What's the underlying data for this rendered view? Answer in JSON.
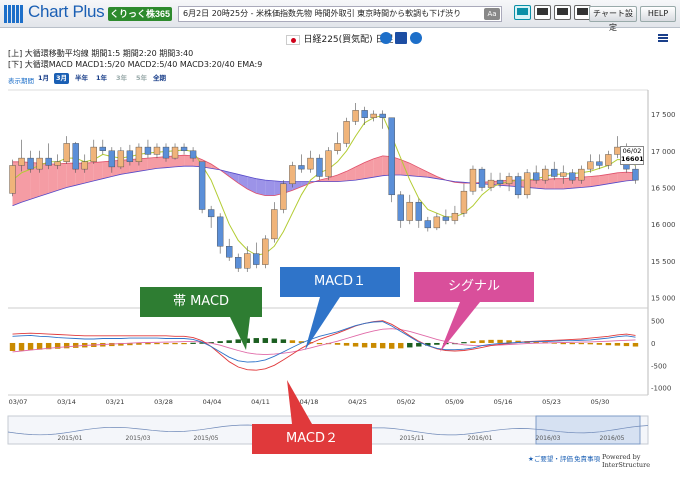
{
  "app": {
    "logo_text": "Chart Plus",
    "brand_badge": "くりっく株365"
  },
  "ticker": {
    "text": "6月2日 20時25分 - 米株価指数先物 時間外取引 東京時間から軟調も下げ渋り",
    "button": "Aa"
  },
  "toolbar": {
    "settings_label": "チャート設定",
    "help_label": "HELP"
  },
  "chart_header": {
    "title": "日経225(買気配) 日足"
  },
  "legend": {
    "line1": "[上] 大循環移動平均線  期間1:5  期間2:20  期間3:40",
    "line2": "[下] 大循環MACD  MACD1:5/20  MACD2:5/40  MACD3:20/40  EMA:9"
  },
  "periods": {
    "label": "表示期間",
    "items": [
      {
        "label": "1月",
        "active": false
      },
      {
        "label": "3月",
        "active": true
      },
      {
        "label": "半年",
        "active": false
      },
      {
        "label": "1年",
        "active": false
      },
      {
        "label": "3年",
        "active": false
      },
      {
        "label": "5年",
        "active": false
      },
      {
        "label": "全期",
        "active": false
      }
    ]
  },
  "price_axis": [
    "17 500",
    "17 000",
    "16 500",
    "16 000",
    "15 500",
    "15 000"
  ],
  "macd_axis": [
    "500",
    "0",
    "-500",
    "-1000"
  ],
  "date_axis": [
    "03/07",
    "03/14",
    "03/21",
    "03/28",
    "04/04",
    "04/11",
    "04/18",
    "04/25",
    "05/02",
    "05/09",
    "05/16",
    "05/23",
    "05/30"
  ],
  "nav_axis": [
    "2015/01",
    "2015/03",
    "2015/05",
    "2015/11",
    "2016/01",
    "2016/03",
    "2016/05"
  ],
  "price_tag": {
    "date": "06/02",
    "value": "16601"
  },
  "callouts": {
    "obi_macd": "帯 MACD",
    "macd1": "MACD１",
    "signal": "シグナル",
    "macd2": "MACD２"
  },
  "footer": {
    "link1": "★ご要望・評価",
    "link2": "免責事項",
    "powered": "Powered by InterStructure"
  },
  "colors": {
    "candle_up": "#f0b47a",
    "candle_down": "#5b8fd8",
    "ma_short": "#b3cc33",
    "cloud_red": "#f27b86",
    "cloud_blue": "#7b6fe0",
    "callout_green": "#2e7d32",
    "callout_blue": "#2f74c9",
    "callout_pink": "#d94f9b",
    "callout_red": "#e0393b"
  },
  "chart_data": {
    "type": "candlestick",
    "price_ylim": [
      14900,
      17800
    ],
    "candles": [
      {
        "o": 16420,
        "c": 16800,
        "h": 16880,
        "l": 16380
      },
      {
        "o": 16800,
        "c": 16900,
        "h": 17150,
        "l": 16720
      },
      {
        "o": 16900,
        "c": 16750,
        "h": 17000,
        "l": 16700
      },
      {
        "o": 16750,
        "c": 16900,
        "h": 17000,
        "l": 16700
      },
      {
        "o": 16900,
        "c": 16800,
        "h": 17100,
        "l": 16750
      },
      {
        "o": 16800,
        "c": 16850,
        "h": 16950,
        "l": 16750
      },
      {
        "o": 16850,
        "c": 17100,
        "h": 17200,
        "l": 16820
      },
      {
        "o": 17100,
        "c": 16750,
        "h": 17120,
        "l": 16700
      },
      {
        "o": 16750,
        "c": 16850,
        "h": 16950,
        "l": 16700
      },
      {
        "o": 16850,
        "c": 17050,
        "h": 17150,
        "l": 16820
      },
      {
        "o": 17050,
        "c": 17000,
        "h": 17150,
        "l": 16950
      },
      {
        "o": 17000,
        "c": 16780,
        "h": 17050,
        "l": 16700
      },
      {
        "o": 16780,
        "c": 17000,
        "h": 17050,
        "l": 16750
      },
      {
        "o": 17000,
        "c": 16850,
        "h": 17080,
        "l": 16800
      },
      {
        "o": 16850,
        "c": 17050,
        "h": 17100,
        "l": 16800
      },
      {
        "o": 17050,
        "c": 16950,
        "h": 17150,
        "l": 16900
      },
      {
        "o": 16950,
        "c": 17050,
        "h": 17100,
        "l": 16900
      },
      {
        "o": 17050,
        "c": 16900,
        "h": 17100,
        "l": 16850
      },
      {
        "o": 16900,
        "c": 17050,
        "h": 17100,
        "l": 16880
      },
      {
        "o": 17050,
        "c": 17000,
        "h": 17100,
        "l": 16950
      },
      {
        "o": 17000,
        "c": 16900,
        "h": 17050,
        "l": 16850
      },
      {
        "o": 16850,
        "c": 16200,
        "h": 16850,
        "l": 16150
      },
      {
        "o": 16200,
        "c": 16100,
        "h": 16250,
        "l": 15950
      },
      {
        "o": 16100,
        "c": 15700,
        "h": 16150,
        "l": 15600
      },
      {
        "o": 15700,
        "c": 15550,
        "h": 15800,
        "l": 15500
      },
      {
        "o": 15550,
        "c": 15400,
        "h": 15600,
        "l": 15350
      },
      {
        "o": 15400,
        "c": 15600,
        "h": 15700,
        "l": 15350
      },
      {
        "o": 15600,
        "c": 15450,
        "h": 15750,
        "l": 15400
      },
      {
        "o": 15450,
        "c": 15800,
        "h": 15850,
        "l": 15400
      },
      {
        "o": 15800,
        "c": 16200,
        "h": 16300,
        "l": 15750
      },
      {
        "o": 16200,
        "c": 16550,
        "h": 16600,
        "l": 16150
      },
      {
        "o": 16550,
        "c": 16800,
        "h": 16850,
        "l": 16500
      },
      {
        "o": 16800,
        "c": 16750,
        "h": 16950,
        "l": 16700
      },
      {
        "o": 16750,
        "c": 16900,
        "h": 17000,
        "l": 16700
      },
      {
        "o": 16900,
        "c": 16650,
        "h": 16950,
        "l": 16600
      },
      {
        "o": 16650,
        "c": 17000,
        "h": 17050,
        "l": 16600
      },
      {
        "o": 17000,
        "c": 17100,
        "h": 17250,
        "l": 16950
      },
      {
        "o": 17100,
        "c": 17400,
        "h": 17450,
        "l": 17050
      },
      {
        "o": 17400,
        "c": 17550,
        "h": 17650,
        "l": 17350
      },
      {
        "o": 17550,
        "c": 17450,
        "h": 17600,
        "l": 17350
      },
      {
        "o": 17450,
        "c": 17500,
        "h": 17550,
        "l": 17400
      },
      {
        "o": 17500,
        "c": 17450,
        "h": 17550,
        "l": 17300
      },
      {
        "o": 17450,
        "c": 16400,
        "h": 17450,
        "l": 16300
      },
      {
        "o": 16400,
        "c": 16050,
        "h": 16450,
        "l": 15950
      },
      {
        "o": 16050,
        "c": 16300,
        "h": 16400,
        "l": 16000
      },
      {
        "o": 16300,
        "c": 16050,
        "h": 16350,
        "l": 15950
      },
      {
        "o": 16050,
        "c": 15950,
        "h": 16100,
        "l": 15900
      },
      {
        "o": 15950,
        "c": 16100,
        "h": 16150,
        "l": 15920
      },
      {
        "o": 16100,
        "c": 16050,
        "h": 16200,
        "l": 16000
      },
      {
        "o": 16050,
        "c": 16150,
        "h": 16250,
        "l": 16000
      },
      {
        "o": 16150,
        "c": 16450,
        "h": 16550,
        "l": 16100
      },
      {
        "o": 16450,
        "c": 16750,
        "h": 16800,
        "l": 16400
      },
      {
        "o": 16750,
        "c": 16500,
        "h": 16780,
        "l": 16450
      },
      {
        "o": 16500,
        "c": 16600,
        "h": 16700,
        "l": 16450
      },
      {
        "o": 16600,
        "c": 16550,
        "h": 16700,
        "l": 16500
      },
      {
        "o": 16550,
        "c": 16650,
        "h": 16700,
        "l": 16450
      },
      {
        "o": 16650,
        "c": 16400,
        "h": 16700,
        "l": 16350
      },
      {
        "o": 16400,
        "c": 16700,
        "h": 16750,
        "l": 16350
      },
      {
        "o": 16700,
        "c": 16600,
        "h": 16800,
        "l": 16550
      },
      {
        "o": 16600,
        "c": 16750,
        "h": 16800,
        "l": 16550
      },
      {
        "o": 16750,
        "c": 16650,
        "h": 16850,
        "l": 16600
      },
      {
        "o": 16650,
        "c": 16700,
        "h": 16800,
        "l": 16550
      },
      {
        "o": 16700,
        "c": 16600,
        "h": 16750,
        "l": 16550
      },
      {
        "o": 16600,
        "c": 16750,
        "h": 16800,
        "l": 16550
      },
      {
        "o": 16750,
        "c": 16850,
        "h": 16950,
        "l": 16700
      },
      {
        "o": 16850,
        "c": 16800,
        "h": 16950,
        "l": 16750
      },
      {
        "o": 16800,
        "c": 16950,
        "h": 17000,
        "l": 16750
      },
      {
        "o": 16950,
        "c": 17050,
        "h": 17200,
        "l": 16900
      },
      {
        "o": 17050,
        "c": 16750,
        "h": 17100,
        "l": 16700
      },
      {
        "o": 16750,
        "c": 16600,
        "h": 16800,
        "l": 16550
      }
    ],
    "ma_short": [
      16600,
      16700,
      16750,
      16800,
      16850,
      16850,
      16900,
      16900,
      16850,
      16880,
      16950,
      16920,
      16900,
      16920,
      16950,
      16970,
      16980,
      16990,
      17000,
      17010,
      16990,
      16800,
      16600,
      16300,
      16000,
      15780,
      15650,
      15580,
      15600,
      15700,
      15900,
      16150,
      16400,
      16600,
      16700,
      16750,
      16850,
      17000,
      17200,
      17380,
      17450,
      17480,
      17200,
      16900,
      16600,
      16350,
      16200,
      16150,
      16100,
      16100,
      16150,
      16250,
      16400,
      16500,
      16550,
      16580,
      16600,
      16600,
      16620,
      16650,
      16680,
      16680,
      16690,
      16700,
      16720,
      16760,
      16800,
      16880,
      16880,
      16800
    ],
    "ma_mid": [
      16850,
      16850,
      16840,
      16830,
      16820,
      16820,
      16830,
      16830,
      16830,
      16840,
      16850,
      16860,
      16870,
      16880,
      16890,
      16900,
      16910,
      16920,
      16930,
      16940,
      16930,
      16880,
      16820,
      16740,
      16650,
      16560,
      16480,
      16420,
      16390,
      16390,
      16420,
      16460,
      16510,
      16560,
      16600,
      16630,
      16670,
      16720,
      16780,
      16840,
      16890,
      16930,
      16920,
      16880,
      16830,
      16770,
      16710,
      16650,
      16600,
      16570,
      16560,
      16560,
      16570,
      16580,
      16590,
      16600,
      16600,
      16600,
      16600,
      16610,
      16620,
      16620,
      16630,
      16640,
      16650,
      16660,
      16680,
      16700,
      16710,
      16700
    ],
    "ma_long": [
      16250,
      16300,
      16340,
      16380,
      16420,
      16460,
      16500,
      16530,
      16560,
      16590,
      16620,
      16650,
      16680,
      16700,
      16720,
      16740,
      16760,
      16770,
      16780,
      16790,
      16790,
      16780,
      16760,
      16740,
      16710,
      16680,
      16650,
      16620,
      16600,
      16590,
      16580,
      16580,
      16580,
      16580,
      16580,
      16580,
      16580,
      16590,
      16600,
      16620,
      16640,
      16660,
      16670,
      16670,
      16660,
      16650,
      16640,
      16620,
      16600,
      16580,
      16570,
      16560,
      16550,
      16540,
      16530,
      16520,
      16510,
      16500,
      16490,
      16480,
      16480,
      16480,
      16490,
      16500,
      16510,
      16530,
      16550,
      16570,
      16590,
      16600
    ],
    "macd1": [
      150,
      160,
      170,
      150,
      140,
      120,
      110,
      100,
      90,
      90,
      100,
      100,
      100,
      110,
      110,
      110,
      110,
      100,
      100,
      100,
      80,
      20,
      -80,
      -200,
      -320,
      -400,
      -430,
      -420,
      -380,
      -300,
      -200,
      -100,
      0,
      80,
      150,
      200,
      250,
      320,
      390,
      440,
      470,
      480,
      380,
      260,
      140,
      20,
      -60,
      -120,
      -150,
      -150,
      -140,
      -110,
      -60,
      -30,
      -10,
      0,
      10,
      20,
      30,
      30,
      40,
      50,
      50,
      60,
      70,
      90,
      110,
      140,
      160,
      130
    ],
    "signal": [
      -200,
      -180,
      -160,
      -140,
      -120,
      -100,
      -85,
      -70,
      -55,
      -45,
      -35,
      -25,
      -15,
      -5,
      5,
      10,
      15,
      20,
      25,
      30,
      30,
      20,
      -5,
      -50,
      -110,
      -170,
      -220,
      -250,
      -260,
      -250,
      -230,
      -200,
      -160,
      -110,
      -60,
      -10,
      40,
      100,
      160,
      220,
      270,
      310,
      320,
      300,
      260,
      200,
      140,
      80,
      30,
      -10,
      -40,
      -55,
      -60,
      -55,
      -45,
      -35,
      -25,
      -15,
      -5,
      0,
      5,
      10,
      15,
      20,
      25,
      30,
      40,
      50,
      60,
      70
    ],
    "macd2": [
      200,
      210,
      220,
      210,
      200,
      190,
      180,
      170,
      160,
      160,
      160,
      160,
      160,
      160,
      160,
      160,
      160,
      160,
      150,
      150,
      120,
      50,
      -80,
      -250,
      -420,
      -540,
      -600,
      -610,
      -580,
      -500,
      -380,
      -250,
      -120,
      -10,
      80,
      150,
      220,
      300,
      380,
      440,
      480,
      500,
      420,
      300,
      160,
      40,
      -60,
      -130,
      -170,
      -180,
      -170,
      -140,
      -100,
      -60,
      -30,
      -10,
      10,
      30,
      40,
      50,
      60,
      70,
      80,
      90,
      110,
      130,
      150,
      180,
      200,
      170
    ],
    "obi": [
      -180,
      -170,
      -160,
      -150,
      -140,
      -130,
      -120,
      -110,
      -100,
      -90,
      -80,
      -70,
      -60,
      -50,
      -40,
      -30,
      -20,
      -10,
      -5,
      0,
      5,
      10,
      20,
      40,
      60,
      80,
      100,
      110,
      110,
      100,
      80,
      60,
      40,
      20,
      0,
      -20,
      -40,
      -60,
      -80,
      -100,
      -110,
      -120,
      -130,
      -120,
      -100,
      -80,
      -60,
      -40,
      -20,
      0,
      20,
      40,
      60,
      70,
      70,
      60,
      50,
      40,
      30,
      20,
      10,
      0,
      -10,
      -20,
      -30,
      -40,
      -50,
      -60,
      -70,
      -80
    ]
  }
}
